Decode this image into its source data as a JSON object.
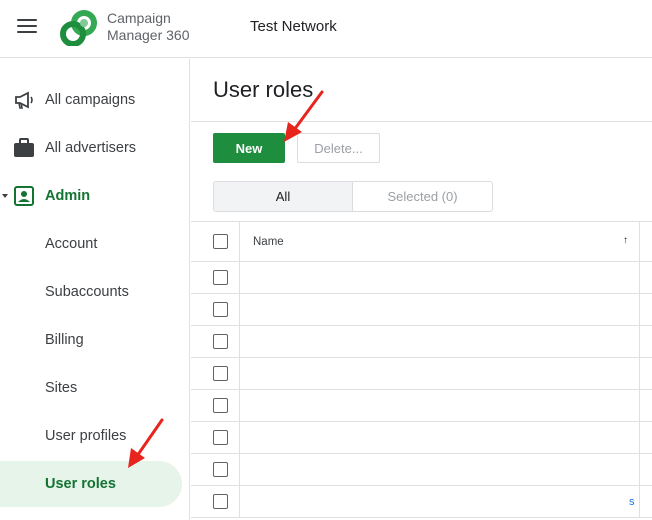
{
  "app": {
    "brand_line1": "Campaign",
    "brand_line2": "Manager 360",
    "network": "Test Network"
  },
  "sidebar": {
    "items": [
      {
        "label": "All campaigns",
        "icon": "megaphone-icon"
      },
      {
        "label": "All advertisers",
        "icon": "briefcase-icon"
      },
      {
        "label": "Admin",
        "icon": "admin-badge-icon",
        "expanded": true
      },
      {
        "label": "Account"
      },
      {
        "label": "Subaccounts"
      },
      {
        "label": "Billing"
      },
      {
        "label": "Sites"
      },
      {
        "label": "User profiles"
      },
      {
        "label": "User roles",
        "active": true
      }
    ]
  },
  "main": {
    "title": "User roles",
    "new_label": "New",
    "delete_label": "Delete...",
    "filter_tabs": [
      "All",
      "Selected (0)"
    ],
    "table": {
      "column_name": "Name",
      "sort_indicator": "↑",
      "row_count": 8,
      "partial_text": "s"
    }
  },
  "colors": {
    "accent_green": "#1e8e3e",
    "active_bg": "#e6f4ea",
    "annotation_red": "#e8251c"
  }
}
